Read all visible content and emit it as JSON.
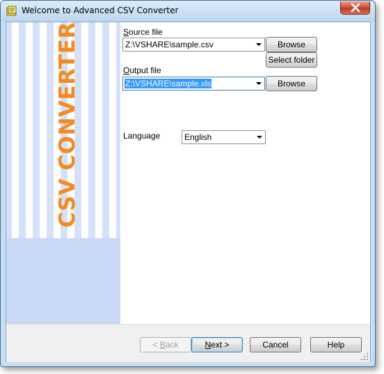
{
  "window": {
    "title": "Welcome to Advanced CSV Converter"
  },
  "sidebar": {
    "vertical_title": "CSV CONVERTER",
    "accent_color": "#f58a20"
  },
  "form": {
    "source_label_key": "S",
    "source_label_rest": "ource file",
    "source_value": "Z:\\VSHARE\\sample.csv",
    "browse_label": "Browse",
    "select_folder_label": "Select folder",
    "output_label_key": "O",
    "output_label_rest": "utput file",
    "output_value": "Z:\\VSHARE\\sample.xls",
    "browse2_label": "Browse",
    "language_label": "Language",
    "language_value": "English"
  },
  "footer": {
    "back_label_pre": "< ",
    "back_label_key": "B",
    "back_label_rest": "ack",
    "next_label_key": "N",
    "next_label_rest": "ext >",
    "cancel_label": "Cancel",
    "help_label": "Help"
  }
}
